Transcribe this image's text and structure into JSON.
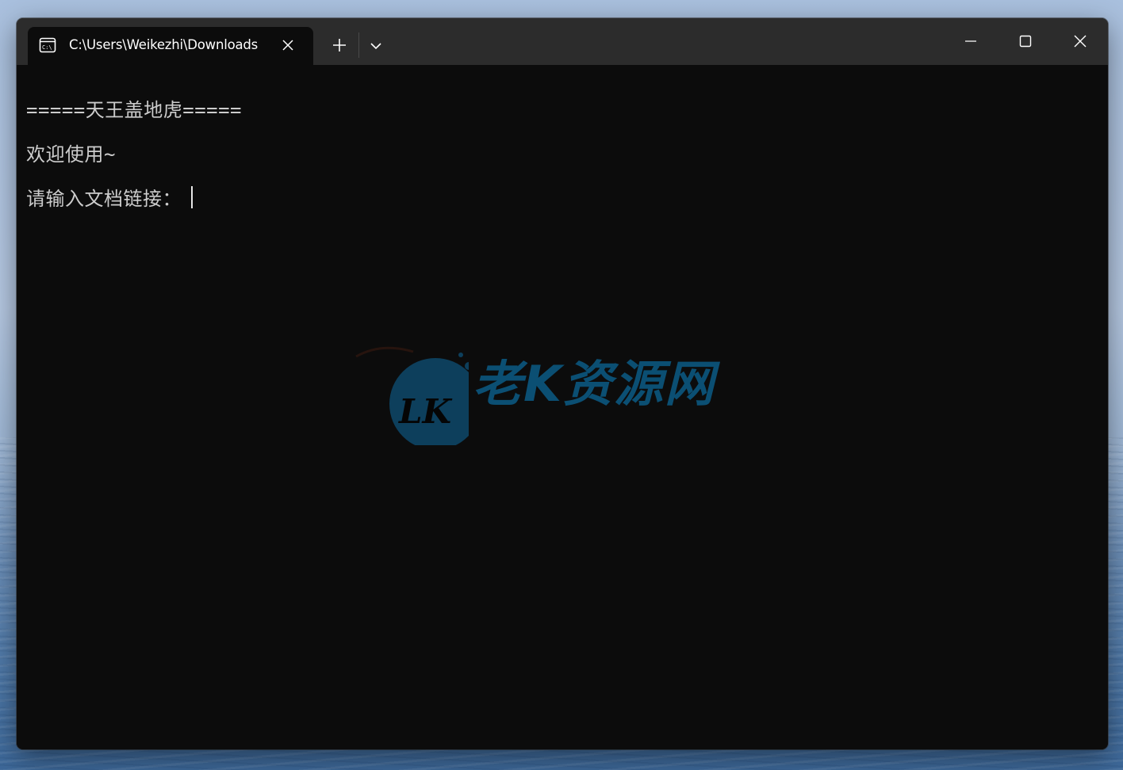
{
  "window": {
    "tab_title": "C:\\Users\\Weikezhi\\Downloads",
    "tab_icon": "command-prompt-icon",
    "colors": {
      "titlebar": "#2c2c2c",
      "terminal_bg": "#0c0c0c",
      "terminal_text": "#cccccc"
    }
  },
  "terminal": {
    "lines": [
      "=====天王盖地虎=====",
      "欢迎使用~",
      "请输入文档链接："
    ]
  },
  "watermark": {
    "logo_letters": "LK",
    "text": "老K资源网",
    "color": "#0b4f73"
  }
}
